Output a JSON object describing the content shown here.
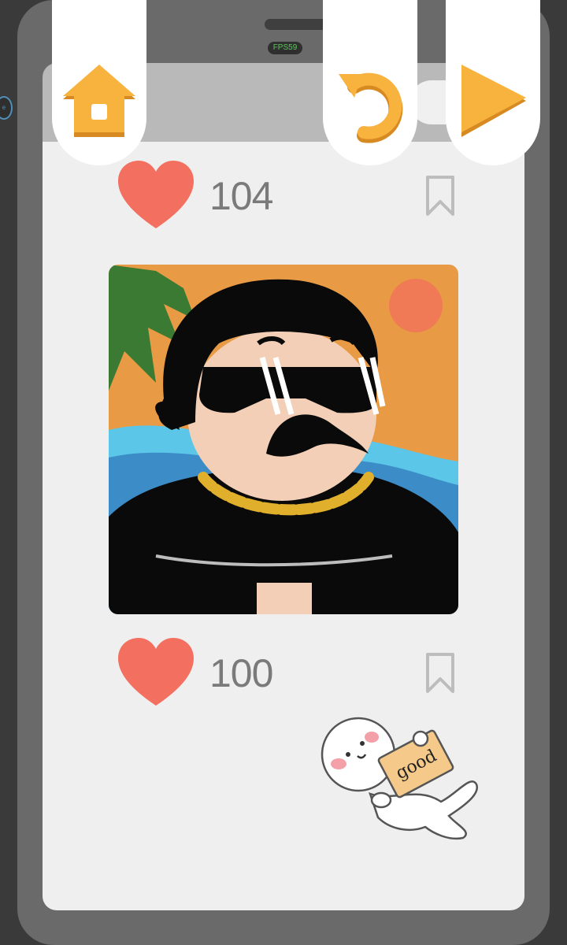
{
  "overlay": {
    "fps": "FPS59"
  },
  "controls": {
    "home": {
      "icon": "home-icon"
    },
    "restart": {
      "icon": "restart-icon"
    },
    "next": {
      "icon": "play-icon"
    }
  },
  "post": {
    "top_likes": "104",
    "bottom_likes": "100",
    "image": "cartoon-man-sunglasses-gold-chain-beach"
  },
  "sticker": {
    "text": "good"
  },
  "colors": {
    "accent": "#f8b33e",
    "heart": "#f36f5f",
    "text_gray": "#7a7a7a"
  }
}
